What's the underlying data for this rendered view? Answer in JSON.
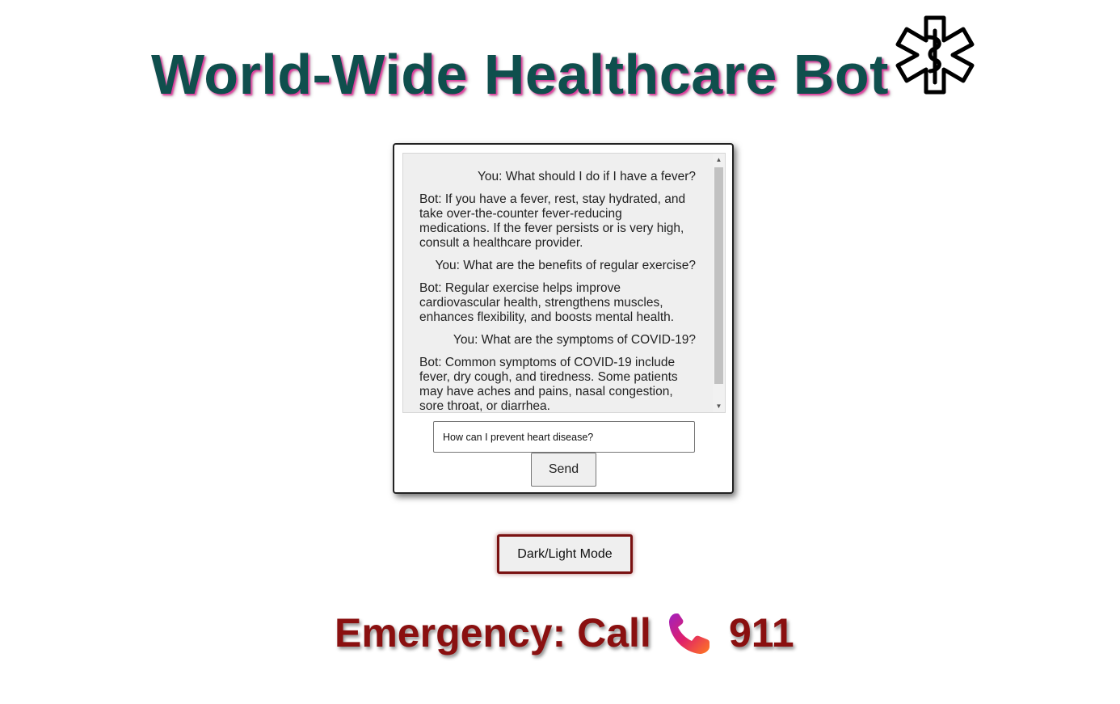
{
  "header": {
    "title": "World-Wide Healthcare Bot",
    "icon": "star-of-life-icon"
  },
  "chat": {
    "messages": [
      {
        "role": "user",
        "text": "You: What should I do if I have a fever?"
      },
      {
        "role": "bot",
        "text": "Bot: If you have a fever, rest, stay hydrated, and take over-the-counter fever-reducing medications. If the fever persists or is very high, consult a healthcare provider."
      },
      {
        "role": "user",
        "text": "You: What are the benefits of regular exercise?"
      },
      {
        "role": "bot",
        "text": "Bot: Regular exercise helps improve cardiovascular health, strengthens muscles, enhances flexibility, and boosts mental health."
      },
      {
        "role": "user",
        "text": "You: What are the symptoms of COVID-19?"
      },
      {
        "role": "bot",
        "text": "Bot: Common symptoms of COVID-19 include fever, dry cough, and tiredness. Some patients may have aches and pains, nasal congestion, sore throat, or diarrhea."
      }
    ],
    "input_value": "How can I prevent heart disease?",
    "send_label": "Send"
  },
  "controls": {
    "mode_label": "Dark/Light Mode"
  },
  "emergency": {
    "label": "Emergency: Call",
    "icon": "phone-icon",
    "number": "911"
  },
  "colors": {
    "title": "#0f4f4d",
    "title_shadow": "#e0389b",
    "emergency": "#8a1010",
    "mode_border": "#7a1111"
  }
}
